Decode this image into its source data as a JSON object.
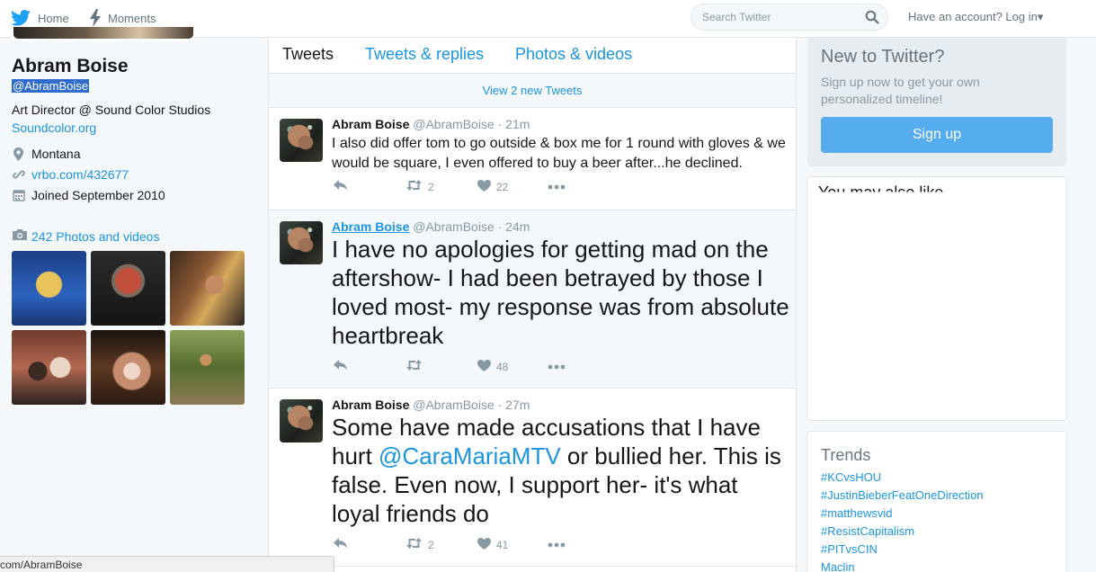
{
  "nav": {
    "home_label": "Home",
    "moments_label": "Moments",
    "search_placeholder": "Search Twitter",
    "login_label": "Have an account? Log in▾"
  },
  "profile": {
    "name": "Abram Boise",
    "handle": "@AbramBoise",
    "bio": "Art Director @ Sound Color Studios",
    "bio_link": "Soundcolor.org",
    "location": "Montana",
    "url": "vrbo.com/432677",
    "joined": "Joined September 2010",
    "photos_link": "242 Photos and videos"
  },
  "timeline": {
    "tabs": [
      "Tweets",
      "Tweets & replies",
      "Photos & videos"
    ],
    "new_tweets": "View 2 new Tweets",
    "tweets": [
      {
        "name": "Abram Boise",
        "handle": "@AbramBoise",
        "time": "· 21m",
        "text": "I also did offer tom to go outside & box me for 1 round with gloves & we would be square, I even offered to buy a beer after...he declined.",
        "retweets": "2",
        "likes": "22"
      },
      {
        "name": "Abram Boise",
        "handle": "@AbramBoise",
        "time": "· 24m",
        "text": "I have no apologies for getting mad on the aftershow- I had been betrayed by those I loved most- my response was from absolute heartbreak",
        "retweets": "",
        "likes": "48"
      },
      {
        "name": "Abram Boise",
        "handle": "@AbramBoise",
        "time": "· 27m",
        "text_before": "Some have made accusations that I have hurt ",
        "mention": "@CaraMariaMTV",
        "text_after": " or bullied her. This is false. Even now, I support her- it's what loyal friends do",
        "retweets": "2",
        "likes": "41"
      }
    ]
  },
  "sidebar": {
    "signup_title": "New to Twitter?",
    "signup_desc": "Sign up now to get your own personalized timeline!",
    "signup_button": "Sign up",
    "wtf_title": "You may also like",
    "trends_title": "Trends",
    "trends": [
      "#KCvsHOU",
      "#JustinBieberFeatOneDirection",
      "#matthewsvid",
      "#ResistCapitalism",
      "#PITvsCIN",
      "Maclin"
    ]
  },
  "status_bar": "com/AbramBoise",
  "colors": {
    "accent": "#1b95e0",
    "signup_button": "#55acee",
    "background": "#f5f8fa"
  }
}
